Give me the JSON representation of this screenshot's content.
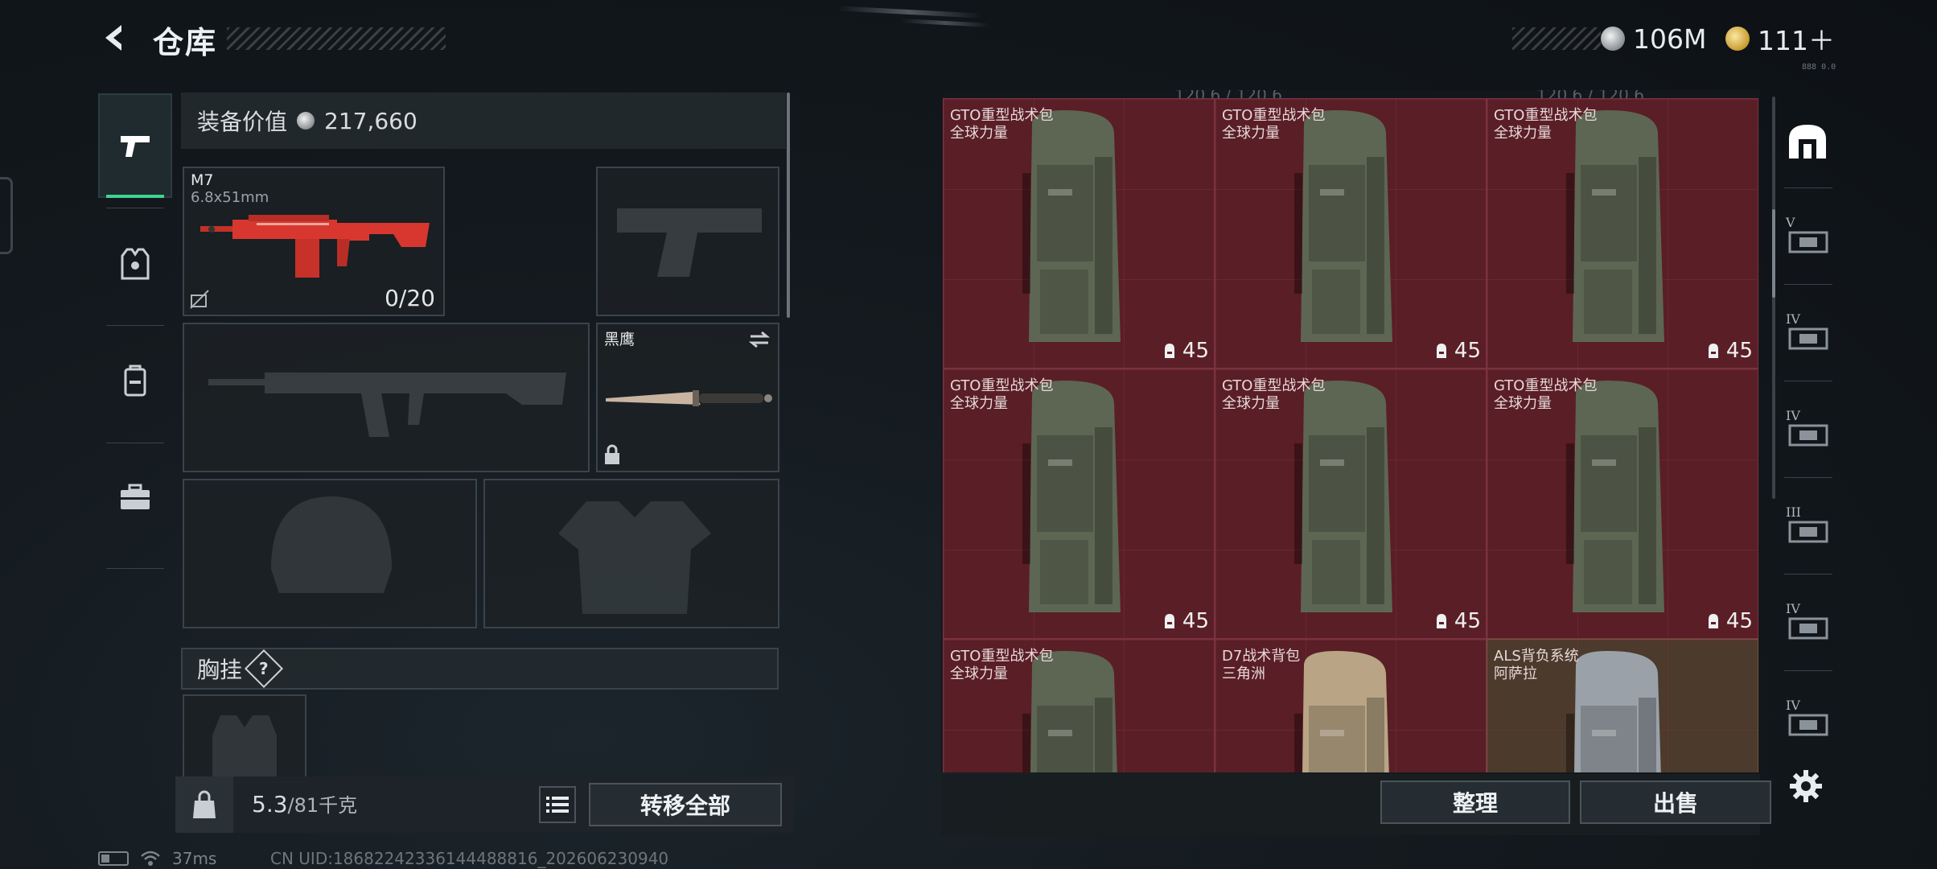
{
  "header": {
    "title": "仓库",
    "currency_silver": "106M",
    "currency_gold": "111＋",
    "tiny_code": "888 0.0"
  },
  "equipment": {
    "value_label": "装备价值",
    "value": "217,660",
    "primary_weapon": {
      "name": "M7",
      "caliber": "6.8x51mm",
      "durability": "0/20"
    },
    "melee": {
      "name": "黑鹰"
    },
    "chest_rig_label": "胸挂",
    "chest_rig_help": "?"
  },
  "bottom_left": {
    "weight_current": "5.3",
    "weight_max": "/81千克",
    "transfer_all": "转移全部"
  },
  "storage": {
    "top_labels": [
      "120.6 / 120.6",
      "120.6 / 120.6"
    ],
    "items": [
      {
        "name": "GTO重型战术包",
        "sub": "全球力量",
        "count": "45",
        "tone": "red",
        "color": "#5d6653"
      },
      {
        "name": "GTO重型战术包",
        "sub": "全球力量",
        "count": "45",
        "tone": "red",
        "color": "#5d6653"
      },
      {
        "name": "GTO重型战术包",
        "sub": "全球力量",
        "count": "45",
        "tone": "red",
        "color": "#5d6653"
      },
      {
        "name": "GTO重型战术包",
        "sub": "全球力量",
        "count": "45",
        "tone": "red",
        "color": "#5d6653"
      },
      {
        "name": "GTO重型战术包",
        "sub": "全球力量",
        "count": "45",
        "tone": "red",
        "color": "#5d6653"
      },
      {
        "name": "GTO重型战术包",
        "sub": "全球力量",
        "count": "45",
        "tone": "red",
        "color": "#5d6653"
      },
      {
        "name": "GTO重型战术包",
        "sub": "全球力量",
        "count": "",
        "tone": "red",
        "color": "#5d6653"
      },
      {
        "name": "D7战术背包",
        "sub": "三角洲",
        "count": "",
        "tone": "red",
        "color": "#b9a585"
      },
      {
        "name": "ALS背负系统",
        "sub": "阿萨拉",
        "count": "",
        "tone": "tan",
        "color": "#9aa1a8"
      }
    ],
    "sort_button": "整理",
    "sell_button": "出售"
  },
  "side_rail": {
    "tiers": [
      "V",
      "IV",
      "IV",
      "III",
      "IV",
      "IV"
    ]
  },
  "status": {
    "ping": "37ms",
    "uid": "CN UID:18682242336144488816_202606230940"
  },
  "colors": {
    "accent": "#3fd38e",
    "cell_red": "#5a1e26",
    "cell_tan": "#4c3a2c",
    "weapon_red": "#d8372f"
  }
}
